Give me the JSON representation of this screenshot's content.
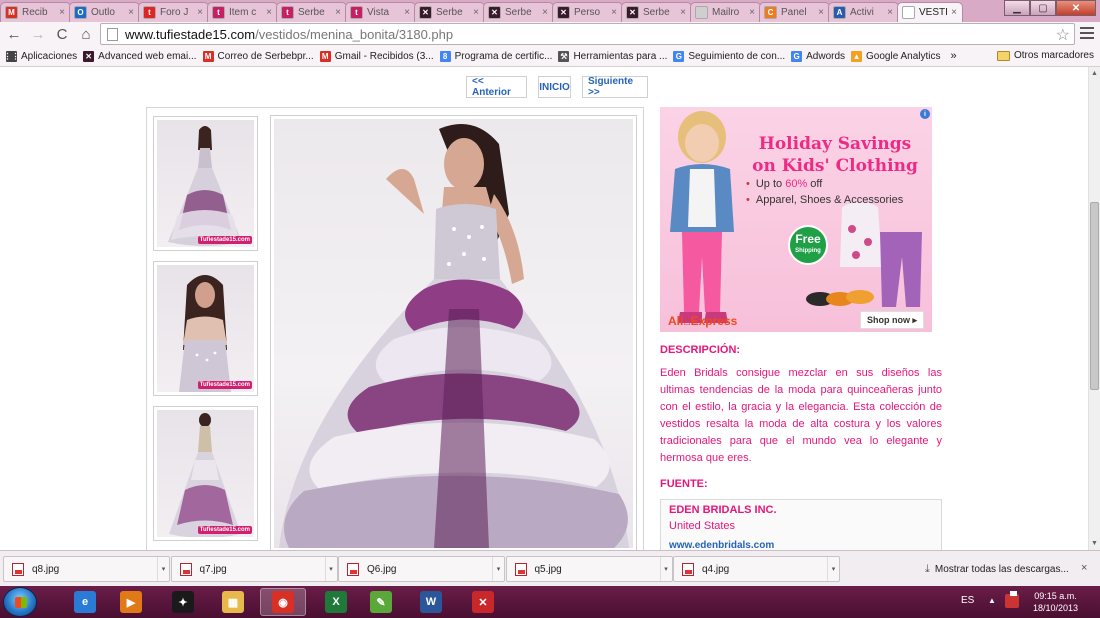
{
  "browser": {
    "tabs": [
      {
        "label": "Recib",
        "icon": "gmail-icon",
        "color": "#d93025",
        "glyph": "M"
      },
      {
        "label": "Outlo",
        "icon": "outlook-icon",
        "color": "#1c6ac9",
        "glyph": "O"
      },
      {
        "label": "Foro J",
        "icon": "foro-icon",
        "color": "#e02424",
        "glyph": "t"
      },
      {
        "label": "Ítem c",
        "icon": "site-logo-icon",
        "color": "#c81e64",
        "glyph": "t"
      },
      {
        "label": "Serbe",
        "icon": "site-logo-icon",
        "color": "#c81e64",
        "glyph": "t"
      },
      {
        "label": "Vista",
        "icon": "site-logo-icon",
        "color": "#c81e64",
        "glyph": "t"
      },
      {
        "label": "Serbe",
        "icon": "butterfly-icon",
        "color": "#3b1a2c",
        "glyph": "✕"
      },
      {
        "label": "Serbe",
        "icon": "butterfly-icon",
        "color": "#3b1a2c",
        "glyph": "✕"
      },
      {
        "label": "Perso",
        "icon": "butterfly-icon",
        "color": "#3b1a2c",
        "glyph": "✕"
      },
      {
        "label": "Serbe",
        "icon": "butterfly-icon",
        "color": "#3b1a2c",
        "glyph": "✕"
      },
      {
        "label": "Mailro",
        "icon": "page-icon",
        "color": "#cfcfcf",
        "glyph": ""
      },
      {
        "label": "Panel",
        "icon": "panel-icon",
        "color": "#f07b1d",
        "glyph": "C"
      },
      {
        "label": "Activi",
        "icon": "activity-icon",
        "color": "#2b5bb0",
        "glyph": "A"
      },
      {
        "label": "VESTI",
        "icon": "page-icon",
        "color": "#ffffff",
        "glyph": "",
        "active": true
      }
    ],
    "close_glyph": "×",
    "url_host": "www.tufiestade15.com",
    "url_path": "/vestidos/menina_bonita/3180.php",
    "back_glyph": "←",
    "forward_glyph": "→",
    "reload_glyph": "C",
    "home_glyph": "⌂",
    "star_glyph": "☆"
  },
  "bookmarks": {
    "items": [
      {
        "label": "Aplicaciones",
        "icon": "apps-grid-icon",
        "color": "#444",
        "glyph": "⋮⋮"
      },
      {
        "label": "Advanced web emai...",
        "icon": "butterfly-icon",
        "color": "#3b1a2c",
        "glyph": "✕"
      },
      {
        "label": "Correo de Serbebpr...",
        "icon": "gmail-icon",
        "color": "#d93025",
        "glyph": "M"
      },
      {
        "label": "Gmail - Recibidos (3...",
        "icon": "gmail-icon",
        "color": "#d93025",
        "glyph": "M"
      },
      {
        "label": "Programa de certific...",
        "icon": "google-icon",
        "color": "#4285f4",
        "glyph": "8"
      },
      {
        "label": "Herramientas para ...",
        "icon": "tools-icon",
        "color": "#555",
        "glyph": "⚒"
      },
      {
        "label": "Seguimiento de con...",
        "icon": "google-icon",
        "color": "#4285f4",
        "glyph": "G"
      },
      {
        "label": "Adwords",
        "icon": "google-icon",
        "color": "#4285f4",
        "glyph": "G"
      },
      {
        "label": "Google Analytics",
        "icon": "analytics-icon",
        "color": "#f4a020",
        "glyph": "▲"
      }
    ],
    "more": "»",
    "other": "Otros marcadores"
  },
  "page": {
    "pager": {
      "prev": "<< Anterior",
      "home": "INICIO",
      "next": "Siguiente >>"
    },
    "thumb_logo": "Tufiestade15.com",
    "ad": {
      "info": "i",
      "title_line1": "Holiday Savings",
      "title_line2": "on Kids' Clothing",
      "bullet1_pre": "Up to ",
      "bullet1_hl": "60%",
      "bullet1_post": " off",
      "bullet2": "Apparel, Shoes & Accessories",
      "badge_main": "Free",
      "badge_sub": "Shipping",
      "logo_a": "Ali",
      "logo_b": "Express",
      "cta": "Shop now ▸"
    },
    "description_heading": "DESCRIPCIÓN:",
    "description_text": "Eden Bridals consigue mezclar en sus diseños las ultimas tendencias de la moda para quinceañeras junto con el estilo, la gracia y la elegancia. Esta colección de vestidos resalta la moda de alta costura y los valores tradicionales para que el mundo vea lo elegante y hermosa que eres.",
    "source_heading": "FUENTE:",
    "source_name": "EDEN BRIDALS INC.",
    "source_country": "United States",
    "source_link": "www.edenbridals.com",
    "colors": {
      "accent": "#e4177b",
      "link": "#2563b8"
    }
  },
  "downloads": {
    "items": [
      {
        "name": "q8.jpg"
      },
      {
        "name": "q7.jpg"
      },
      {
        "name": "Q6.jpg"
      },
      {
        "name": "q5.jpg"
      },
      {
        "name": "q4.jpg"
      }
    ],
    "dropdown_glyph": "▾",
    "show_all": "Mostrar todas las descargas...",
    "close_glyph": "×"
  },
  "taskbar": {
    "apps": [
      {
        "name": "internet-explorer-icon",
        "color": "#2a7bd6",
        "glyph": "e"
      },
      {
        "name": "media-player-icon",
        "color": "#e07a16",
        "glyph": "▶"
      },
      {
        "name": "game-app-icon",
        "color": "#1a1a1a",
        "glyph": "✦"
      },
      {
        "name": "file-explorer-icon",
        "color": "#e7b84a",
        "glyph": "▦"
      },
      {
        "name": "chrome-icon",
        "color": "#d93025",
        "glyph": "◉",
        "active": true
      },
      {
        "name": "excel-icon",
        "color": "#1f7a3a",
        "glyph": "X"
      },
      {
        "name": "green-app-icon",
        "color": "#5aa83a",
        "glyph": "✎"
      },
      {
        "name": "word-icon",
        "color": "#2b579a",
        "glyph": "W"
      },
      {
        "name": "red-app-icon",
        "color": "#c8282a",
        "glyph": "✕"
      }
    ],
    "lang": "ES",
    "tray_arrow": "▲",
    "time": "09:15 a.m.",
    "date": "18/10/2013"
  }
}
